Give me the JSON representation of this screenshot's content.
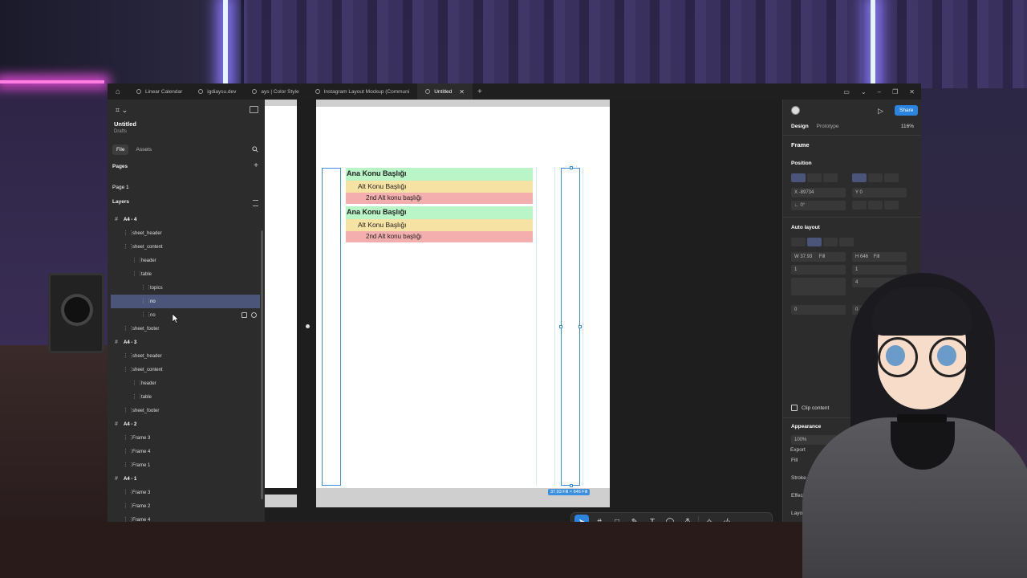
{
  "tabs": [
    {
      "label": "Linear Calendar",
      "active": false
    },
    {
      "label": "igdiaysu.dev",
      "active": false
    },
    {
      "label": "ays | Color Style",
      "active": false
    },
    {
      "label": "Instagram Layout Mockup (Communi",
      "active": false
    },
    {
      "label": "Untitled",
      "active": true
    }
  ],
  "file": {
    "title": "Untitled",
    "subtitle": "Drafts"
  },
  "left_panel": {
    "tab_file": "File",
    "tab_assets": "Assets",
    "pages_heading": "Pages",
    "pages": [
      "Page 1"
    ],
    "layers_heading": "Layers",
    "layers": [
      {
        "label": "A4 - 4",
        "kind": "frame",
        "indent": 0
      },
      {
        "label": "sheet_header",
        "kind": "item",
        "indent": 1
      },
      {
        "label": "sheet_content",
        "kind": "item",
        "indent": 1
      },
      {
        "label": "header",
        "kind": "item",
        "indent": 2
      },
      {
        "label": "table",
        "kind": "item",
        "indent": 2
      },
      {
        "label": "topics",
        "kind": "item",
        "indent": 3
      },
      {
        "label": "no",
        "kind": "item",
        "indent": 3,
        "selected": true
      },
      {
        "label": "no",
        "kind": "item",
        "indent": 3,
        "hovered": true
      },
      {
        "label": "sheet_footer",
        "kind": "item",
        "indent": 1
      },
      {
        "label": "A4 - 3",
        "kind": "frame",
        "indent": 0
      },
      {
        "label": "sheet_header",
        "kind": "item",
        "indent": 1
      },
      {
        "label": "sheet_content",
        "kind": "item",
        "indent": 1
      },
      {
        "label": "header",
        "kind": "item",
        "indent": 2
      },
      {
        "label": "table",
        "kind": "item",
        "indent": 2
      },
      {
        "label": "sheet_footer",
        "kind": "item",
        "indent": 1
      },
      {
        "label": "A4 - 2",
        "kind": "frame",
        "indent": 0
      },
      {
        "label": "Frame 3",
        "kind": "item",
        "indent": 1
      },
      {
        "label": "Frame 4",
        "kind": "item",
        "indent": 1
      },
      {
        "label": "Frame 1",
        "kind": "item",
        "indent": 1
      },
      {
        "label": "A4 - 1",
        "kind": "frame",
        "indent": 0
      },
      {
        "label": "Frame 3",
        "kind": "item",
        "indent": 1
      },
      {
        "label": "Frame 2",
        "kind": "item",
        "indent": 1
      },
      {
        "label": "Frame 4",
        "kind": "item",
        "indent": 1
      }
    ]
  },
  "canvas": {
    "rows": [
      {
        "text": "Ana Konu Başlığı",
        "level": 1
      },
      {
        "text": "Alt Konu Başlığı",
        "level": 2
      },
      {
        "text": "2nd Alt konu başlığı",
        "level": 3
      },
      {
        "text": "Ana Konu Başlığı",
        "level": 1
      },
      {
        "text": "Alt Konu Başlığı",
        "level": 2
      },
      {
        "text": "2nd Alt konu başlığı",
        "level": 3
      }
    ],
    "dimension_label": "37.93 Fill × 646 Fill"
  },
  "right_panel": {
    "share_label": "Share",
    "tab_design": "Design",
    "tab_prototype": "Prototype",
    "zoom": "116%",
    "frame_label": "Frame",
    "position_heading": "Position",
    "x_value": "X  -89734",
    "y_value": "Y  0",
    "rotation_value": "∟  0°",
    "auto_layout_heading": "Auto layout",
    "w_value": "W  37.93",
    "w_mode": "Fill",
    "h_value": "H  646",
    "h_mode": "Fill",
    "gap_a": "1",
    "gap_b": "1",
    "gap_c": "4",
    "pad_a": "0",
    "pad_b": "0",
    "clip_label": "Clip content",
    "appearance_heading": "Appearance",
    "opacity_value": "100%",
    "fill_heading": "Fill",
    "stroke_heading": "Stroke",
    "effects_heading": "Effects",
    "layout_guide_heading": "Layout guide",
    "export_heading": "Export"
  }
}
